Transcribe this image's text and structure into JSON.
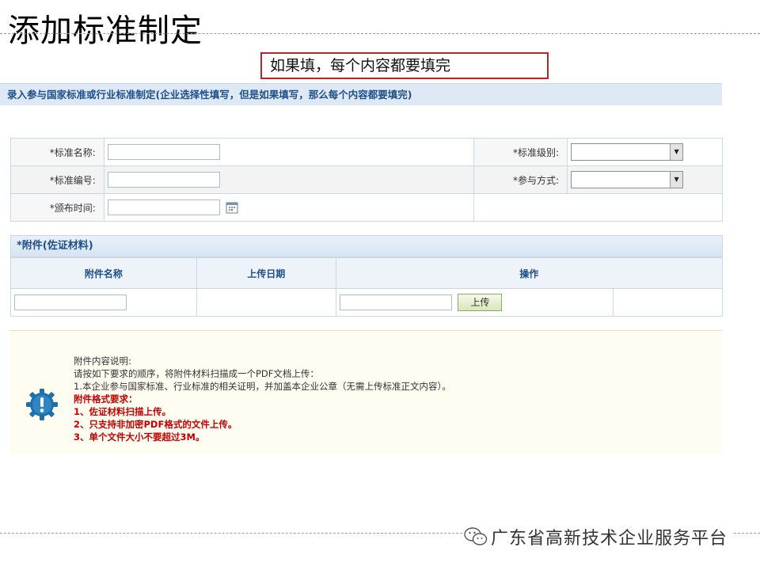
{
  "slide": {
    "title": "添加标准制定"
  },
  "callout": {
    "text": "如果填，每个内容都要填完"
  },
  "section": {
    "title": "录入参与国家标准或行业标准制定(企业选择性填写，但是如果填写，那么每个内容都要填完)"
  },
  "form": {
    "std_name_label": "*标准名称:",
    "std_level_label": "*标准级别:",
    "std_number_label": "*标准编号:",
    "participation_label": "*参与方式:",
    "publish_time_label": "*颁布时间:",
    "std_name_value": "",
    "std_number_value": "",
    "publish_time_value": "",
    "std_level_value": "",
    "participation_value": ""
  },
  "attachment": {
    "title": "*附件(佐证材料)",
    "columns": [
      "附件名称",
      "上传日期",
      "操作"
    ],
    "name_value": "",
    "file_value": "",
    "upload_label": "上传"
  },
  "note": {
    "lines": [
      "附件内容说明:",
      "请按如下要求的顺序，将附件材料扫描成一个PDF文档上传：",
      "1.本企业参与国家标准、行业标准的相关证明，并加盖本企业公章（无需上传标准正文内容）。"
    ],
    "format_title": "附件格式要求：",
    "format_items": [
      "1、佐证材料扫描上传。",
      "2、只支持非加密PDF格式的文件上传。",
      "3、单个文件大小不要超过3M。"
    ]
  },
  "brand": {
    "text": "广东省高新技术企业服务平台"
  },
  "colors": {
    "accent": "#1d4f8a",
    "warning": "#c40000",
    "callout_border": "#b5262b"
  }
}
